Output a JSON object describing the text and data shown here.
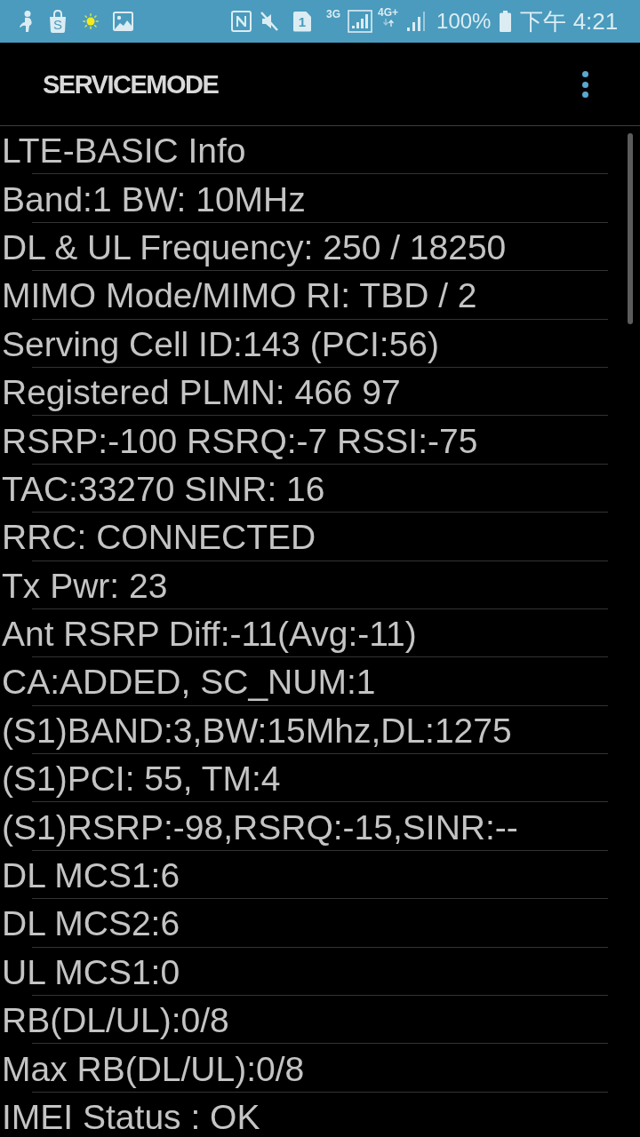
{
  "status_bar": {
    "shop_icon_letter": "S",
    "sim_slot": "1",
    "network_type_1": "3G",
    "network_type_2": "4G+",
    "battery": "100%",
    "time": "下午 4:21"
  },
  "app_bar": {
    "title": "SERVICEMODE"
  },
  "info_lines": [
    "LTE-BASIC Info",
    "Band:1 BW: 10MHz",
    "DL & UL Frequency: 250 / 18250",
    "MIMO Mode/MIMO RI: TBD / 2",
    "Serving Cell ID:143 (PCI:56)",
    "Registered PLMN: 466 97",
    "RSRP:-100 RSRQ:-7 RSSI:-75",
    "TAC:33270 SINR: 16",
    "RRC: CONNECTED",
    "Tx Pwr: 23",
    "Ant RSRP Diff:-11(Avg:-11)",
    "CA:ADDED, SC_NUM:1",
    "(S1)BAND:3,BW:15Mhz,DL:1275",
    "(S1)PCI: 55, TM:4",
    "(S1)RSRP:-98,RSRQ:-15,SINR:--",
    "DL MCS1:6",
    "DL MCS2:6",
    "UL MCS1:0",
    "RB(DL/UL):0/8",
    "Max RB(DL/UL):0/8",
    "IMEI Status : OK"
  ]
}
